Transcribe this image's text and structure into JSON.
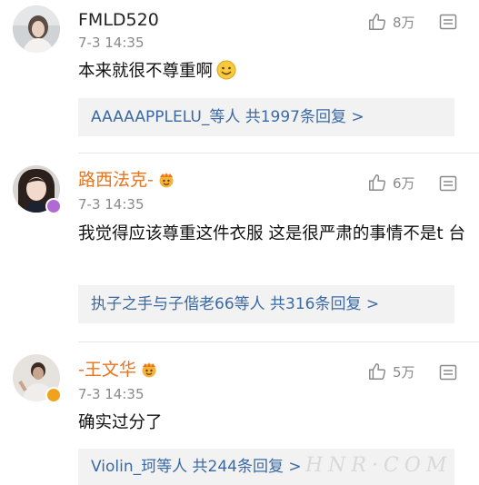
{
  "colors": {
    "name_orange": "#e8741e",
    "link_blue": "#3b6aa3",
    "muted_gray": "#8a8a8a",
    "reply_bg": "#f2f2f2"
  },
  "comments": [
    {
      "username": "FMLD520",
      "time": "7-3 14:35",
      "likes": "8万",
      "text": "本来就很不尊重啊",
      "text_emoji": "smile-emoji",
      "replies": "AAAAAPPLELU_等人  共1997条回复 >"
    },
    {
      "username": "路西法克-",
      "time": "7-3 14:35",
      "likes": "6万",
      "text": "我觉得应该尊重这件衣服  这是很严肃的事情不是t 台",
      "badge": "crown-badge-icon",
      "verified": "purple",
      "replies": "执子之手与子偕老66等人  共316条回复 >"
    },
    {
      "username": "-王文华",
      "time": "7-3 14:35",
      "likes": "5万",
      "text": "确实过分了",
      "badge": "crown-badge-icon",
      "verified": "orange",
      "replies": "Violin_珂等人  共244条回复 >"
    }
  ],
  "watermark": "HNR·COM"
}
